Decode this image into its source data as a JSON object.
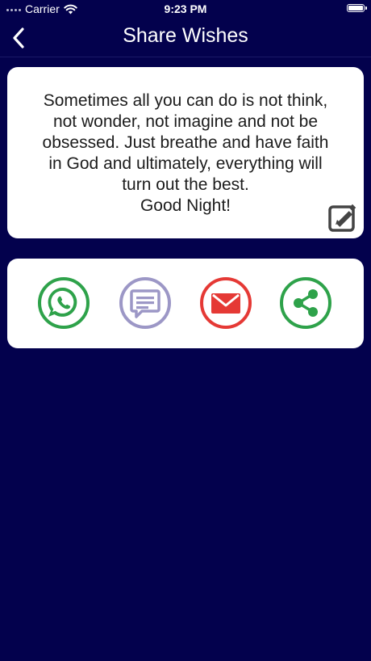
{
  "status_bar": {
    "carrier": "Carrier",
    "time": "9:23 PM",
    "battery_level": 1.0
  },
  "nav": {
    "title": "Share Wishes",
    "back_icon": "chevron-left-icon"
  },
  "message": {
    "text": "Sometimes all you can do is not think,\nnot wonder, not imagine and not be\nobsessed. Just breathe and have faith\nin God and ultimately, everything will\nturn out the best.\nGood Night!",
    "edit_icon": "edit-icon"
  },
  "share": {
    "buttons": [
      {
        "name": "whatsapp-icon",
        "color": "#2ea24a"
      },
      {
        "name": "message-icon",
        "color": "#9c97c6"
      },
      {
        "name": "email-icon",
        "color": "#e53935"
      },
      {
        "name": "share-icon",
        "color": "#2ea24a"
      }
    ]
  },
  "colors": {
    "background": "#03014d",
    "card": "#ffffff",
    "text": "#1c1c1c"
  }
}
